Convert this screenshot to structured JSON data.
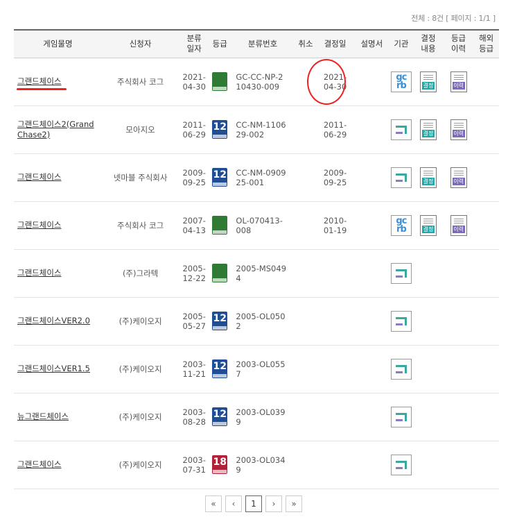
{
  "summary": {
    "total_label": "전체 : 8건",
    "page_label": "[ 페이지 : 1/1 ]"
  },
  "headers": {
    "name": "게임물명",
    "applicant": "신청자",
    "date": "분류일자",
    "rating": "등급",
    "number": "분류번호",
    "cancel": "취소",
    "decision_date": "결정일",
    "manual": "설명서",
    "agency": "기관",
    "decision_content": "결정내용",
    "rating_history": "등급이력",
    "overseas": "해외등급"
  },
  "rows": [
    {
      "name": "그랜드체이스",
      "applicant": "주식회사 코그",
      "date": "2021-04-30",
      "rating": "all",
      "rating_label": "전체이용가",
      "number": "GC-CC-NP-210430-009",
      "decision_date": "2021-04-30",
      "agency": "gc",
      "decision_label": "결정",
      "history_label": "이력"
    },
    {
      "name": "그랜드체이스2(Grand Chase2)",
      "applicant": "모아지오",
      "date": "2011-06-29",
      "rating": "r12",
      "rating_label": "12세이용가",
      "number": "CC-NM-110629-002",
      "decision_date": "2011-06-29",
      "agency": "grac",
      "decision_label": "결정",
      "history_label": "이력"
    },
    {
      "name": "그랜드체이스",
      "applicant": "넷마블 주식회사",
      "date": "2009-09-25",
      "rating": "r12",
      "rating_label": "12세이용가",
      "number": "CC-NM-090925-001",
      "decision_date": "2009-09-25",
      "agency": "grac",
      "decision_label": "결정",
      "history_label": "이력"
    },
    {
      "name": "그랜드체이스",
      "applicant": "주식회사 코그",
      "date": "2007-04-13",
      "rating": "all",
      "rating_label": "전체이용가",
      "number": "OL-070413-008",
      "decision_date": "2010-01-19",
      "agency": "gc",
      "decision_label": "결정",
      "history_label": "이력"
    },
    {
      "name": "그랜드체이스",
      "applicant": "(주)그라텍",
      "date": "2005-12-22",
      "rating": "all",
      "rating_label": "전체이용가",
      "number": "2005-MS0494",
      "decision_date": "",
      "agency": "grac",
      "decision_label": "",
      "history_label": ""
    },
    {
      "name": "그랜드체이스VER2.0",
      "applicant": "(주)케이오지",
      "date": "2005-05-27",
      "rating": "r12",
      "rating_label": "12세이용가",
      "number": "2005-OL0502",
      "decision_date": "",
      "agency": "grac",
      "decision_label": "",
      "history_label": ""
    },
    {
      "name": "그랜드체이스VER1.5",
      "applicant": "(주)케이오지",
      "date": "2003-11-21",
      "rating": "r12",
      "rating_label": "12세이용가",
      "number": "2003-OL0557",
      "decision_date": "",
      "agency": "grac",
      "decision_label": "",
      "history_label": ""
    },
    {
      "name": "뉴그랜드체이스",
      "applicant": "(주)케이오지",
      "date": "2003-08-28",
      "rating": "r12",
      "rating_label": "12세이용가",
      "number": "2003-OL0399",
      "decision_date": "",
      "agency": "grac",
      "decision_label": "",
      "history_label": ""
    },
    {
      "name": "그랜드체이스",
      "applicant": "(주)케이오지",
      "date": "2003-07-31",
      "rating": "r18",
      "rating_label": "청소년이용불가",
      "number": "2003-OL0349",
      "decision_date": "",
      "agency": "grac",
      "decision_label": "",
      "history_label": ""
    }
  ],
  "pagination": {
    "first": "«",
    "prev": "‹",
    "current": "1",
    "next": "›",
    "last": "»"
  },
  "colors": {
    "annotation_red": "#ee2222",
    "rating_all": "#2f7a35",
    "rating_12": "#1f4e94",
    "rating_18": "#b0223a",
    "decision_tag": "#20a8a8",
    "history_tag": "#7b6bb8"
  },
  "icons": {
    "agency_gc": "gc-agency-logo-icon",
    "agency_grac": "grac-agency-logo-icon",
    "decision": "decision-document-icon",
    "history": "history-document-icon"
  }
}
